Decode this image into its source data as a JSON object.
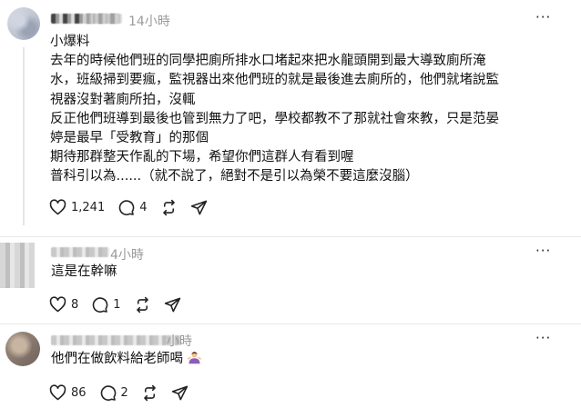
{
  "posts": [
    {
      "time": "14小時",
      "more_label": "···",
      "lines": [
        "小爆料",
        "去年的時候他們班的同學把廁所排水口堵起來把水龍頭開到最大導致廁所淹",
        "水，班級掃到要瘋，監視器出來他們班的就是最後進去廁所的，他們就堵說監",
        "視器沒對著廁所拍，沒輒",
        "反正他們班導到最後也管到無力了吧，學校都教不了那就社會來教，只是范晏",
        "婷是最早「受教育」的那個",
        "期待那群整天作亂的下場，希望你們這群人有看到喔",
        "普科引以為......（就不說了，絕對不是引以為榮不要這麼沒腦）"
      ],
      "likes": "1,241",
      "replies": "4"
    },
    {
      "time": "4小時",
      "more_label": "···",
      "lines": [
        "這是在幹嘛"
      ],
      "likes": "8",
      "replies": "1"
    },
    {
      "time": "小時",
      "more_label": "···",
      "lines": [
        "他們在做飲料給老師喝"
      ],
      "likes": "86",
      "replies": "2"
    }
  ],
  "icons": {
    "like": "heart-icon",
    "reply": "comment-icon",
    "repost": "repost-icon",
    "share": "send-icon"
  }
}
